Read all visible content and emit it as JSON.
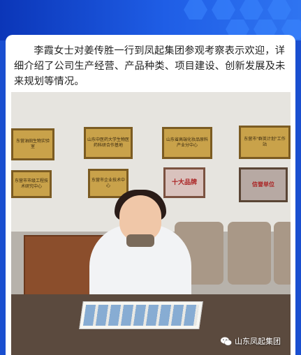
{
  "article": {
    "paragraph": "李霞女士对姜传胜一行到凤起集团参观考察表示欢迎，详细介绍了公司生产经营、产品种类、项目建设、创新发展及未来规划等情况。"
  },
  "photo": {
    "plaques": [
      {
        "text": "东营油田生物实验室"
      },
      {
        "text": "山东中医药大学生物医药科研合作基地"
      },
      {
        "text": "山东省高端化妆品原料产业分中心"
      },
      {
        "text": "东营市\"群英计划\"工作站"
      },
      {
        "text": "东营市市级工程技术研究中心"
      },
      {
        "text": "东营市企业技术中心"
      },
      {
        "text": "十大品牌"
      },
      {
        "text": "信誉单位"
      }
    ],
    "watermark": {
      "icon": "wechat-icon",
      "label": "山东凤起集团"
    }
  },
  "colors": {
    "header": "#1f5ee6",
    "card": "#ffffff",
    "text": "#222222"
  }
}
